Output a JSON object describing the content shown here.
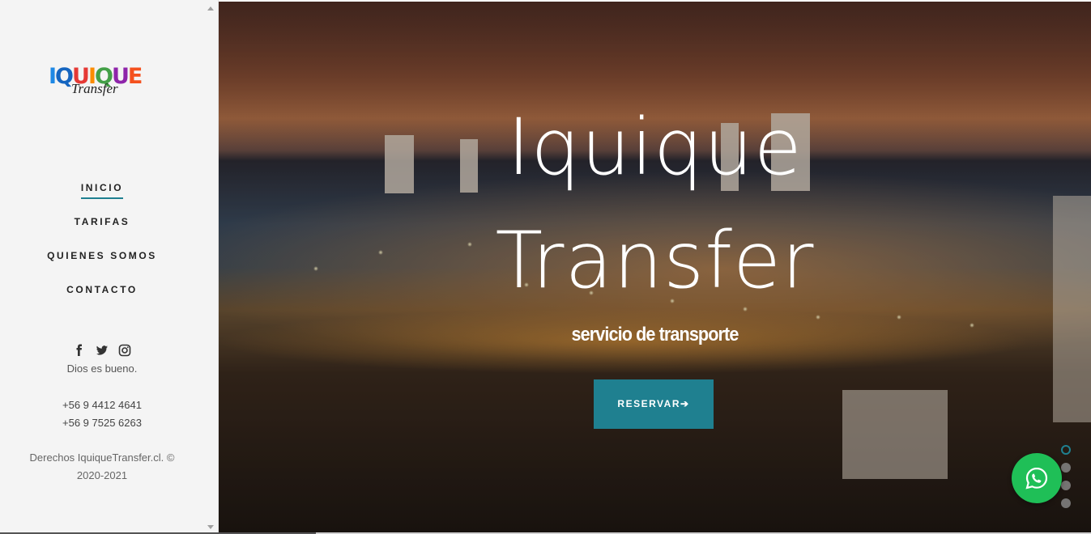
{
  "sidebar": {
    "logo": {
      "letters": [
        "I",
        "Q",
        "U",
        "I",
        "Q",
        "U",
        "E"
      ],
      "letter_colors": [
        "#1e88e5",
        "#1565c0",
        "#e53935",
        "#fb8c00",
        "#43a047",
        "#8e24aa",
        "#f4511e"
      ],
      "sub": "Transfer"
    },
    "nav": [
      {
        "label": "INICIO",
        "active": true
      },
      {
        "label": "TARIFAS",
        "active": false
      },
      {
        "label": "QUIENES SOMOS",
        "active": false
      },
      {
        "label": "CONTACTO",
        "active": false
      }
    ],
    "social_icons": [
      "facebook-icon",
      "twitter-icon",
      "instagram-icon"
    ],
    "tagline": "Dios es bueno.",
    "phones": [
      "+56 9 4412 4641",
      "+56 9 7525 6263"
    ],
    "copyright_line1": "Derechos IquiqueTransfer.cl. ©",
    "copyright_line2": "2020-2021"
  },
  "hero": {
    "title_line1": "Iquique",
    "title_line2": "Transfer",
    "subtitle": "servicio de transporte",
    "button_label": "RESERVAR➔",
    "slides_count": 4,
    "active_slide": 1
  },
  "colors": {
    "accent": "#1f8090",
    "whatsapp": "#1fbf57"
  }
}
